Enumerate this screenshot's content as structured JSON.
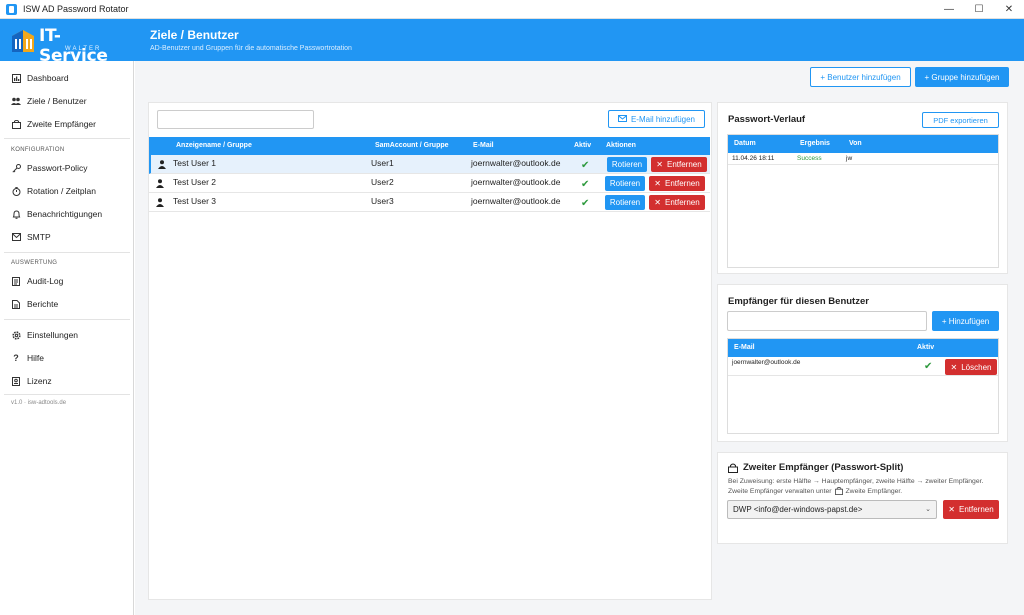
{
  "window": {
    "title": "ISW AD Password Rotator",
    "controls": [
      "—",
      "☐",
      "✕"
    ]
  },
  "header": {
    "logo_text": "IT-Service",
    "logo_sub": "WALTER",
    "title": "Ziele / Benutzer",
    "subtitle": "AD-Benutzer und Gruppen für die automatische Passwortrotation"
  },
  "sidebar": {
    "items_top": [
      {
        "label": "Dashboard",
        "icon": "dashboard-icon"
      },
      {
        "label": "Ziele / Benutzer",
        "icon": "users-icon"
      },
      {
        "label": "Zweite Empfänger",
        "icon": "second-recipient-icon"
      }
    ],
    "section_config": "KONFIGURATION",
    "items_config": [
      {
        "label": "Passwort-Policy",
        "icon": "key-icon"
      },
      {
        "label": "Rotation / Zeitplan",
        "icon": "timer-icon"
      },
      {
        "label": "Benachrichtigungen",
        "icon": "bell-icon"
      },
      {
        "label": "SMTP",
        "icon": "mail-icon"
      }
    ],
    "section_eval": "AUSWERTUNG",
    "items_eval": [
      {
        "label": "Audit-Log",
        "icon": "log-icon"
      },
      {
        "label": "Berichte",
        "icon": "report-icon"
      }
    ],
    "items_bottom": [
      {
        "label": "Einstellungen",
        "icon": "gear-icon"
      },
      {
        "label": "Hilfe",
        "icon": "help-icon"
      },
      {
        "label": "Lizenz",
        "icon": "license-icon"
      }
    ],
    "version": "v1.0 · isw-adtools.de"
  },
  "actions": {
    "add_user": "+ Benutzer hinzufügen",
    "add_group": "+ Gruppe hinzufügen"
  },
  "targets": {
    "search_placeholder": "",
    "email_add": "E-Mail hinzufügen",
    "columns": [
      "Anzeigename / Gruppe",
      "SamAccount / Gruppe",
      "E-Mail",
      "Aktiv",
      "Aktionen"
    ],
    "rows": [
      {
        "name": "Test User 1",
        "sam": "User1",
        "email": "joernwalter@outlook.de",
        "active": "✔",
        "rotate": "Rotieren",
        "remove": "Entfernen"
      },
      {
        "name": "Test User 2",
        "sam": "User2",
        "email": "joernwalter@outlook.de",
        "active": "✔",
        "rotate": "Rotieren",
        "remove": "Entfernen"
      },
      {
        "name": "Test User 3",
        "sam": "User3",
        "email": "joernwalter@outlook.de",
        "active": "✔",
        "rotate": "Rotieren",
        "remove": "Entfernen"
      }
    ]
  },
  "history": {
    "title": "Passwort-Verlauf",
    "export": "PDF exportieren",
    "columns": [
      "Datum",
      "Ergebnis",
      "Von"
    ],
    "rows": [
      {
        "date": "11.04.26 18:11",
        "result": "Success",
        "by": "jw"
      }
    ]
  },
  "recipients": {
    "title": "Empfänger für diesen Benutzer",
    "input_placeholder": "",
    "add": "+ Hinzufügen",
    "columns": [
      "E-Mail",
      "Aktiv"
    ],
    "rows": [
      {
        "email": "joernwalter@outlook.de",
        "active": "✔",
        "delete": "Löschen"
      }
    ]
  },
  "second": {
    "title": "Zweiter Empfänger (Passwort-Split)",
    "desc1": "Bei Zuweisung: erste Hälfte → Hauptempfänger, zweite Hälfte → zweiter Empfänger.",
    "desc2a": "Zweite Empfänger verwalten unter",
    "desc2b": "Zweite Empfänger.",
    "select_value": "DWP <info@der-windows-papst.de>",
    "remove": "Entfernen"
  },
  "colors": {
    "accent": "#2196f3",
    "danger": "#d32f2f",
    "success": "#2e9a3e"
  }
}
